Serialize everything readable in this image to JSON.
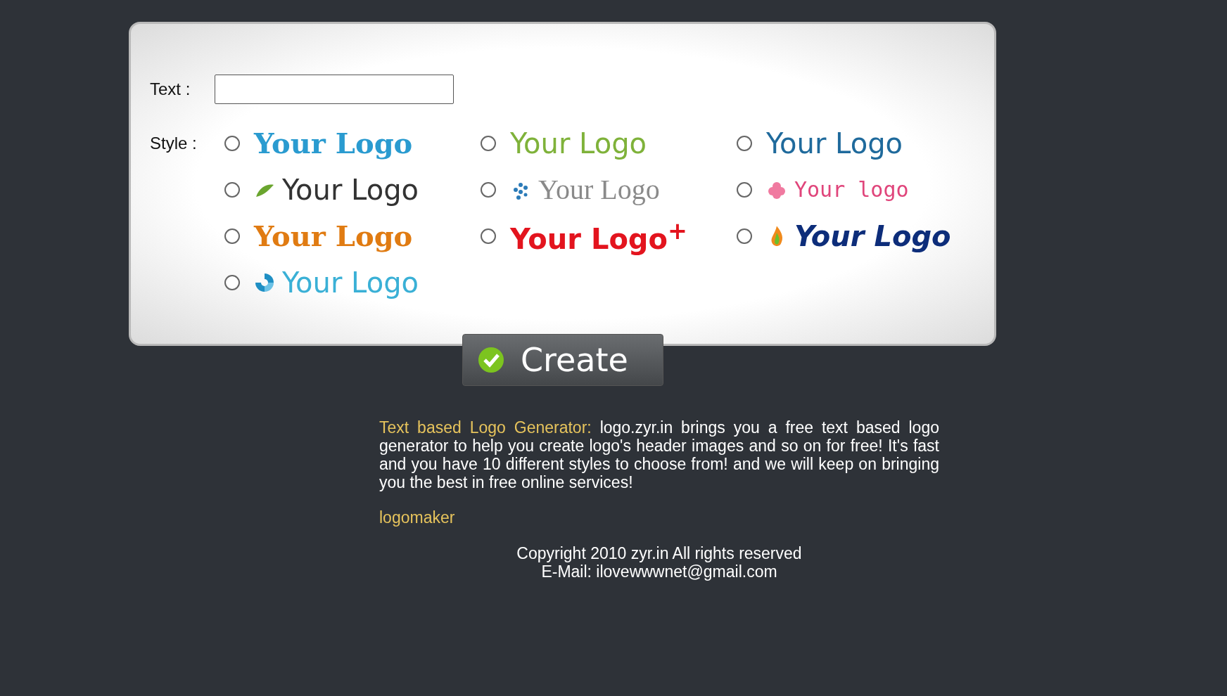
{
  "form": {
    "text_label": "Text :",
    "style_label": "Style :",
    "styles": [
      {
        "text": "Your Logo",
        "kind": "serif",
        "color": "#2a9bd0",
        "selected": false
      },
      {
        "text": "Your Logo",
        "kind": "rounded",
        "color": "#7fb23a",
        "selected": false
      },
      {
        "text": "Your Logo",
        "kind": "plain",
        "color": "#1f6a9c",
        "selected": false
      },
      {
        "text": "Your Logo",
        "kind": "leaf",
        "color": "#333333",
        "selected": false
      },
      {
        "text": "Your Logo",
        "kind": "dots",
        "color": "#8a8a8a",
        "selected": false
      },
      {
        "text": "Your logo",
        "kind": "flower",
        "color": "#e0457b",
        "selected": false
      },
      {
        "text": "Your Logo",
        "kind": "bold",
        "color": "#e07b12",
        "selected": false
      },
      {
        "text": "Your Logo$^{+}$",
        "kind": "plus",
        "color": "#e3141e",
        "selected": false
      },
      {
        "text": "Your Logo",
        "kind": "flame",
        "color": "#0d2d7a",
        "selected": false
      },
      {
        "text": "Your Logo",
        "kind": "swirl",
        "color": "#3ab0d6",
        "selected": false
      }
    ],
    "button": "Create"
  },
  "intro": {
    "lead": "Text based Logo Generator:",
    "body": " logo.zyr.in brings you a free text based logo generator to help you create logo's header images and so on for free! It's fast and you have 10 different styles to choose from! and we will keep on bringing you the best in free online services!"
  },
  "link": "logomaker",
  "footer": [
    "Copyright 2010 zyr.in All rights reserved",
    "E-Mail: ilovewwwnet@gmail.com"
  ]
}
